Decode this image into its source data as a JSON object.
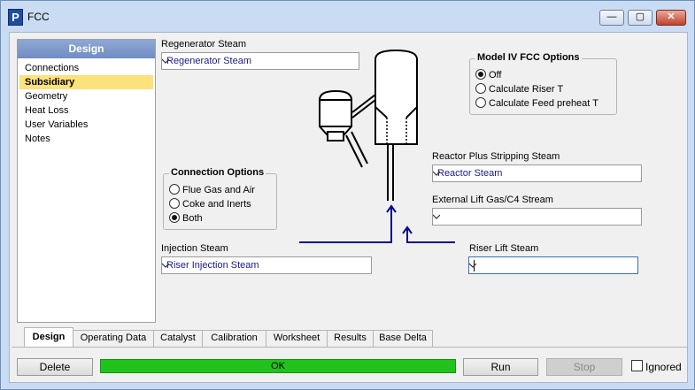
{
  "window": {
    "title": "FCC",
    "app_icon": "P"
  },
  "titlebar_buttons": {
    "minimize": "—",
    "maximize": "▢",
    "close": "✕"
  },
  "nav": {
    "header": "Design",
    "items": [
      {
        "label": "Connections"
      },
      {
        "label": "Subsidiary"
      },
      {
        "label": "Geometry"
      },
      {
        "label": "Heat Loss"
      },
      {
        "label": "User Variables"
      },
      {
        "label": "Notes"
      }
    ],
    "selected": "Subsidiary"
  },
  "regenerator_steam": {
    "label": "Regenerator Steam",
    "value": "Regenerator Steam"
  },
  "model_iv": {
    "title": "Model IV FCC Options",
    "options": [
      "Off",
      "Calculate Riser T",
      "Calculate Feed preheat T"
    ],
    "selected": "Off"
  },
  "connection_options": {
    "title": "Connection Options",
    "options": [
      "Flue Gas and Air",
      "Coke and Inerts",
      "Both"
    ],
    "selected": "Both"
  },
  "reactor_plus_stripping_steam": {
    "label": "Reactor Plus Stripping Steam",
    "value": "Reactor Steam"
  },
  "external_lift_gas": {
    "label": "External Lift Gas/C4 Stream",
    "value": ""
  },
  "injection_steam": {
    "label": "Injection Steam",
    "value": "Riser Injection Steam"
  },
  "riser_lift_steam": {
    "label": "Riser Lift Steam",
    "value": ""
  },
  "tabs": [
    "Design",
    "Operating Data",
    "Catalyst",
    "Calibration",
    "Worksheet",
    "Results",
    "Base Delta"
  ],
  "active_tab": "Design",
  "bottom": {
    "delete": "Delete",
    "status": "OK",
    "run": "Run",
    "stop": "Stop",
    "ignored": "Ignored",
    "ignored_checked": false,
    "status_color": "#22c21c"
  },
  "colors": {
    "stream_arrow": "#0a0a8c",
    "nav_selected": "#fde27c"
  }
}
